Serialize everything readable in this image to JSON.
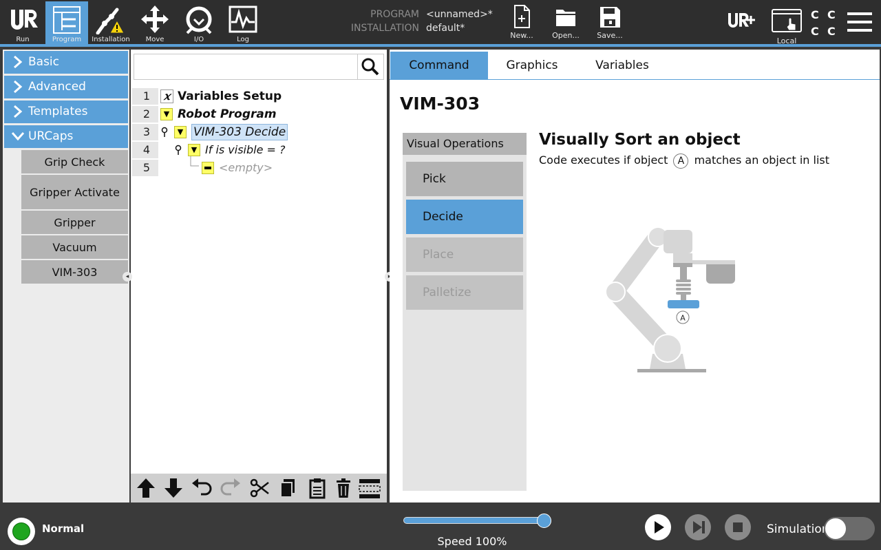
{
  "topbar": {
    "nav": [
      {
        "label": "Run",
        "icon": "ur-logo-icon"
      },
      {
        "label": "Program",
        "icon": "program-icon",
        "active": true
      },
      {
        "label": "Installation",
        "icon": "installation-warning-icon"
      },
      {
        "label": "Move",
        "icon": "move-arrows-icon"
      },
      {
        "label": "I/O",
        "icon": "io-icon"
      },
      {
        "label": "Log",
        "icon": "log-chart-icon"
      }
    ],
    "program_label": "PROGRAM",
    "program_value": "<unnamed>*",
    "installation_label": "INSTALLATION",
    "installation_value": "default*",
    "new_label": "New...",
    "open_label": "Open...",
    "save_label": "Save...",
    "local_label": "Local",
    "cc": [
      "C",
      "C",
      "C",
      "C"
    ]
  },
  "sidebar": {
    "categories": [
      "Basic",
      "Advanced",
      "Templates",
      "URCaps"
    ],
    "urcaps_items": [
      "Grip Check",
      "Gripper Activate",
      "Gripper",
      "Vacuum",
      "VIM-303"
    ]
  },
  "tree": {
    "search_placeholder": "",
    "lines": [
      {
        "num": "1",
        "text": "Variables Setup",
        "style": "bold"
      },
      {
        "num": "2",
        "text": "Robot Program",
        "style": "bold-italic"
      },
      {
        "num": "3",
        "text": "VIM-303 Decide",
        "style": "italic-selected"
      },
      {
        "num": "4",
        "text": "If is visible = ?",
        "style": "italic"
      },
      {
        "num": "5",
        "text": "<empty>",
        "style": "empty"
      }
    ]
  },
  "right": {
    "tabs": [
      "Command",
      "Graphics",
      "Variables"
    ],
    "active_tab": "Command",
    "title": "VIM-303",
    "visual_ops_header": "Visual Operations",
    "ops": [
      {
        "label": "Pick",
        "state": "normal"
      },
      {
        "label": "Decide",
        "state": "active"
      },
      {
        "label": "Place",
        "state": "disabled"
      },
      {
        "label": "Palletize",
        "state": "disabled"
      }
    ],
    "op_title": "Visually Sort an object",
    "op_desc_before": "Code executes if object",
    "op_desc_marker": "A",
    "op_desc_after": "matches an object in list",
    "robot_marker": "A"
  },
  "bottom": {
    "status": "Normal",
    "speed_text": "Speed 100%",
    "speed_value": 100,
    "simulation_label": "Simulation",
    "simulation_on": false
  },
  "colors": {
    "accent": "#5aa0d8",
    "status_green": "#1fa51f"
  }
}
